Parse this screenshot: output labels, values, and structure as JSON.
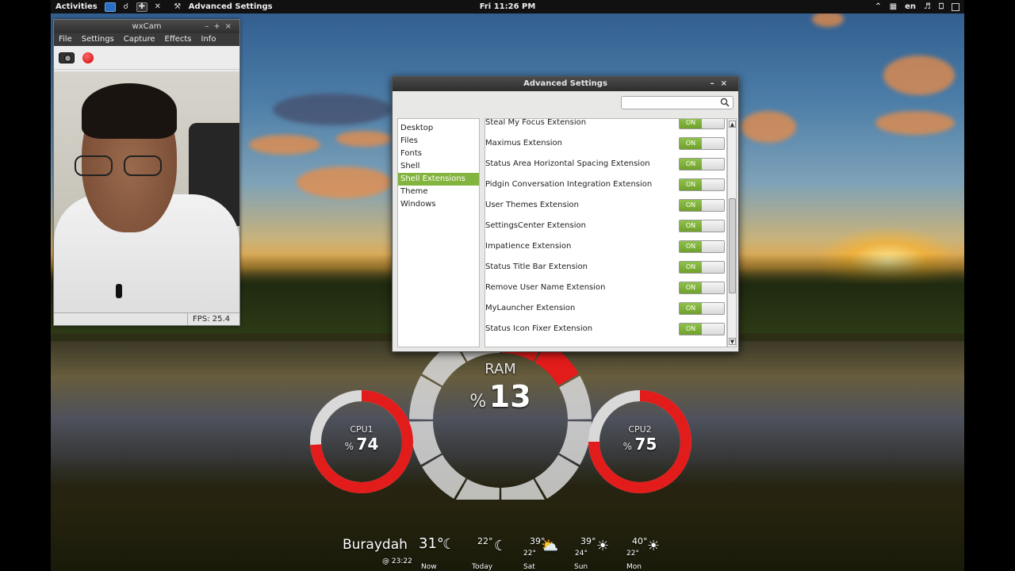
{
  "top_panel": {
    "activities": "Activities",
    "app_name": "Advanced Settings",
    "clock": "Fri 11:26 PM",
    "keyboard": "en"
  },
  "wxcam": {
    "title": "wxCam",
    "menu": [
      "File",
      "Settings",
      "Capture",
      "Effects",
      "Info"
    ],
    "fps": "FPS: 25.4"
  },
  "advanced_settings": {
    "title": "Advanced Settings",
    "search_placeholder": "",
    "sidebar": [
      "Desktop",
      "Files",
      "Fonts",
      "Shell",
      "Shell Extensions",
      "Theme",
      "Windows"
    ],
    "active_sidebar_index": 4,
    "switch_on_label": "ON",
    "extensions": [
      "Steal My Focus Extension",
      "Maximus Extension",
      "Status Area Horizontal Spacing Extension",
      "Pidgin Conversation Integration Extension",
      "User Themes Extension",
      "SettingsCenter Extension",
      "Impatience Extension",
      "Status Title Bar Extension",
      "Remove User Name Extension",
      "MyLauncher Extension",
      "Status Icon Fixer Extension"
    ]
  },
  "conky": {
    "ram": {
      "label": "RAM",
      "percent_sign": "%",
      "value": "13",
      "fraction": 0.13
    },
    "cpu1": {
      "label": "CPU1",
      "percent_sign": "%",
      "value": "74",
      "fraction": 0.74
    },
    "cpu2": {
      "label": "CPU2",
      "percent_sign": "%",
      "value": "75",
      "fraction": 0.75
    },
    "gauge_color": "#e21b1b",
    "track_color": "#d9d9d9"
  },
  "weather": {
    "city": "Buraydah",
    "now_temp": "31°",
    "updated": "@ 23:22",
    "days": [
      {
        "name": "Now",
        "high": "",
        "low": ""
      },
      {
        "name": "Today",
        "high": "22°",
        "low": ""
      },
      {
        "name": "Sat",
        "high": "39°",
        "low": "22°"
      },
      {
        "name": "Sun",
        "high": "39°",
        "low": "24°"
      },
      {
        "name": "Mon",
        "high": "40°",
        "low": "22°"
      }
    ]
  }
}
